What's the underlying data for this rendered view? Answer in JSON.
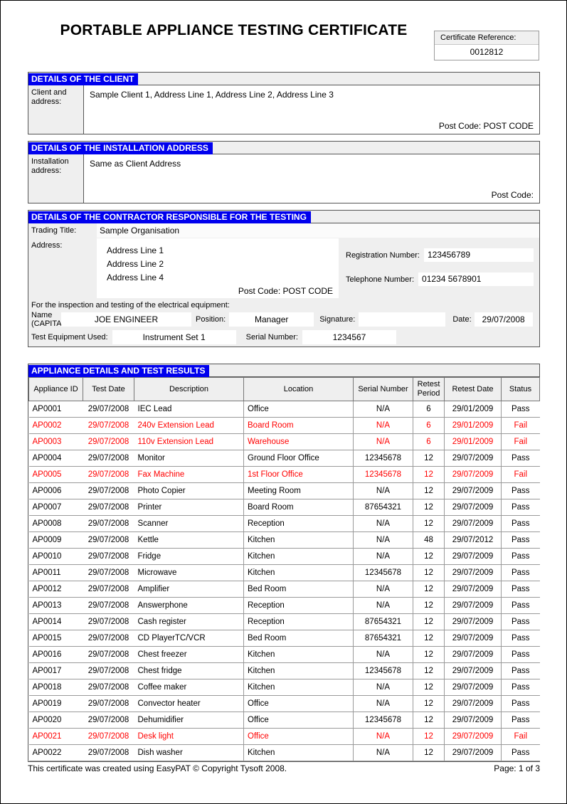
{
  "document": {
    "title": "PORTABLE APPLIANCE TESTING CERTIFICATE",
    "certificate_reference_label": "Certificate Reference:",
    "certificate_reference_value": "0012812"
  },
  "client": {
    "band_title": "DETAILS OF THE CLIENT",
    "label": "Client and address:",
    "address": "Sample Client 1, Address Line 1, Address Line 2, Address Line 3",
    "post_code_label": "Post Code:",
    "post_code_value": "POST CODE"
  },
  "installation": {
    "band_title": "DETAILS OF THE INSTALLATION ADDRESS",
    "label": "Installation address:",
    "address": "Same as Client Address",
    "post_code_label": "Post Code:",
    "post_code_value": ""
  },
  "contractor": {
    "band_title": "DETAILS OF THE CONTRACTOR RESPONSIBLE FOR THE TESTING",
    "trading_title_label": "Trading Title:",
    "trading_title_value": "Sample Organisation",
    "address_label": "Address:",
    "address_line_1": "Address Line 1",
    "address_line_2": "Address Line 2",
    "address_line_3": "Address Line 4",
    "post_code_label": "Post Code:",
    "post_code_value": "POST CODE",
    "registration_label": "Registration Number:",
    "registration_value": "123456789",
    "telephone_label": "Telephone Number:",
    "telephone_value": "01234 5678901",
    "inspection_note": "For the inspection and testing of the electrical equipment:",
    "name_label_line1": "Name",
    "name_label_line2": "(CAPITALS:",
    "name_value": "JOE ENGINEER",
    "position_label": "Position:",
    "position_value": "Manager",
    "signature_label": "Signature:",
    "signature_value": "",
    "date_label": "Date:",
    "date_value": "29/07/2008",
    "test_equipment_label": "Test Equipment Used:",
    "test_equipment_value": "Instrument Set 1",
    "serial_number_label": "Serial Number:",
    "serial_number_value": "1234567"
  },
  "results": {
    "band_title": "APPLIANCE DETAILS AND TEST RESULTS",
    "columns": [
      "Appliance ID",
      "Test Date",
      "Description",
      "Location",
      "Serial Number",
      "Retest Period",
      "Retest Date",
      "Status"
    ],
    "rows": [
      {
        "id": "AP0001",
        "test_date": "29/07/2008",
        "description": "IEC Lead",
        "location": "Office",
        "serial": "N/A",
        "retest_period": "6",
        "retest_date": "29/01/2009",
        "status": "Pass"
      },
      {
        "id": "AP0002",
        "test_date": "29/07/2008",
        "description": "240v Extension Lead",
        "location": "Board Room",
        "serial": "N/A",
        "retest_period": "6",
        "retest_date": "29/01/2009",
        "status": "Fail"
      },
      {
        "id": "AP0003",
        "test_date": "29/07/2008",
        "description": "110v Extension Lead",
        "location": "Warehouse",
        "serial": "N/A",
        "retest_period": "6",
        "retest_date": "29/01/2009",
        "status": "Fail"
      },
      {
        "id": "AP0004",
        "test_date": "29/07/2008",
        "description": "Monitor",
        "location": "Ground Floor Office",
        "serial": "12345678",
        "retest_period": "12",
        "retest_date": "29/07/2009",
        "status": "Pass"
      },
      {
        "id": "AP0005",
        "test_date": "29/07/2008",
        "description": "Fax Machine",
        "location": "1st Floor Office",
        "serial": "12345678",
        "retest_period": "12",
        "retest_date": "29/07/2009",
        "status": "Fail"
      },
      {
        "id": "AP0006",
        "test_date": "29/07/2008",
        "description": "Photo Copier",
        "location": "Meeting Room",
        "serial": "N/A",
        "retest_period": "12",
        "retest_date": "29/07/2009",
        "status": "Pass"
      },
      {
        "id": "AP0007",
        "test_date": "29/07/2008",
        "description": "Printer",
        "location": "Board Room",
        "serial": "87654321",
        "retest_period": "12",
        "retest_date": "29/07/2009",
        "status": "Pass"
      },
      {
        "id": "AP0008",
        "test_date": "29/07/2008",
        "description": "Scanner",
        "location": "Reception",
        "serial": "N/A",
        "retest_period": "12",
        "retest_date": "29/07/2009",
        "status": "Pass"
      },
      {
        "id": "AP0009",
        "test_date": "29/07/2008",
        "description": "Kettle",
        "location": "Kitchen",
        "serial": "N/A",
        "retest_period": "48",
        "retest_date": "29/07/2012",
        "status": "Pass"
      },
      {
        "id": "AP0010",
        "test_date": "29/07/2008",
        "description": "Fridge",
        "location": "Kitchen",
        "serial": "N/A",
        "retest_period": "12",
        "retest_date": "29/07/2009",
        "status": "Pass"
      },
      {
        "id": "AP0011",
        "test_date": "29/07/2008",
        "description": "Microwave",
        "location": "Kitchen",
        "serial": "12345678",
        "retest_period": "12",
        "retest_date": "29/07/2009",
        "status": "Pass"
      },
      {
        "id": "AP0012",
        "test_date": "29/07/2008",
        "description": "Amplifier",
        "location": "Bed Room",
        "serial": "N/A",
        "retest_period": "12",
        "retest_date": "29/07/2009",
        "status": "Pass"
      },
      {
        "id": "AP0013",
        "test_date": "29/07/2008",
        "description": "Answerphone",
        "location": "Reception",
        "serial": "N/A",
        "retest_period": "12",
        "retest_date": "29/07/2009",
        "status": "Pass"
      },
      {
        "id": "AP0014",
        "test_date": "29/07/2008",
        "description": "Cash register",
        "location": "Reception",
        "serial": "87654321",
        "retest_period": "12",
        "retest_date": "29/07/2009",
        "status": "Pass"
      },
      {
        "id": "AP0015",
        "test_date": "29/07/2008",
        "description": "CD PlayerTC/VCR",
        "location": "Bed Room",
        "serial": "87654321",
        "retest_period": "12",
        "retest_date": "29/07/2009",
        "status": "Pass"
      },
      {
        "id": "AP0016",
        "test_date": "29/07/2008",
        "description": "Chest freezer",
        "location": "Kitchen",
        "serial": "N/A",
        "retest_period": "12",
        "retest_date": "29/07/2009",
        "status": "Pass"
      },
      {
        "id": "AP0017",
        "test_date": "29/07/2008",
        "description": "Chest fridge",
        "location": "Kitchen",
        "serial": "12345678",
        "retest_period": "12",
        "retest_date": "29/07/2009",
        "status": "Pass"
      },
      {
        "id": "AP0018",
        "test_date": "29/07/2008",
        "description": "Coffee maker",
        "location": "Kitchen",
        "serial": "N/A",
        "retest_period": "12",
        "retest_date": "29/07/2009",
        "status": "Pass"
      },
      {
        "id": "AP0019",
        "test_date": "29/07/2008",
        "description": "Convector heater",
        "location": "Office",
        "serial": "N/A",
        "retest_period": "12",
        "retest_date": "29/07/2009",
        "status": "Pass"
      },
      {
        "id": "AP0020",
        "test_date": "29/07/2008",
        "description": "Dehumidifier",
        "location": "Office",
        "serial": "12345678",
        "retest_period": "12",
        "retest_date": "29/07/2009",
        "status": "Pass"
      },
      {
        "id": "AP0021",
        "test_date": "29/07/2008",
        "description": "Desk light",
        "location": "Office",
        "serial": "N/A",
        "retest_period": "12",
        "retest_date": "29/07/2009",
        "status": "Fail"
      },
      {
        "id": "AP0022",
        "test_date": "29/07/2008",
        "description": "Dish washer",
        "location": "Kitchen",
        "serial": "N/A",
        "retest_period": "12",
        "retest_date": "29/07/2009",
        "status": "Pass"
      }
    ]
  },
  "footer": {
    "created_text": "This certificate was created using EasyPAT © Copyright Tysoft 2008.",
    "page_text": "Page: 1 of 3"
  },
  "colors": {
    "band": "#0000EE",
    "fail": "#FF0000",
    "panel": "#EFEFEF"
  }
}
